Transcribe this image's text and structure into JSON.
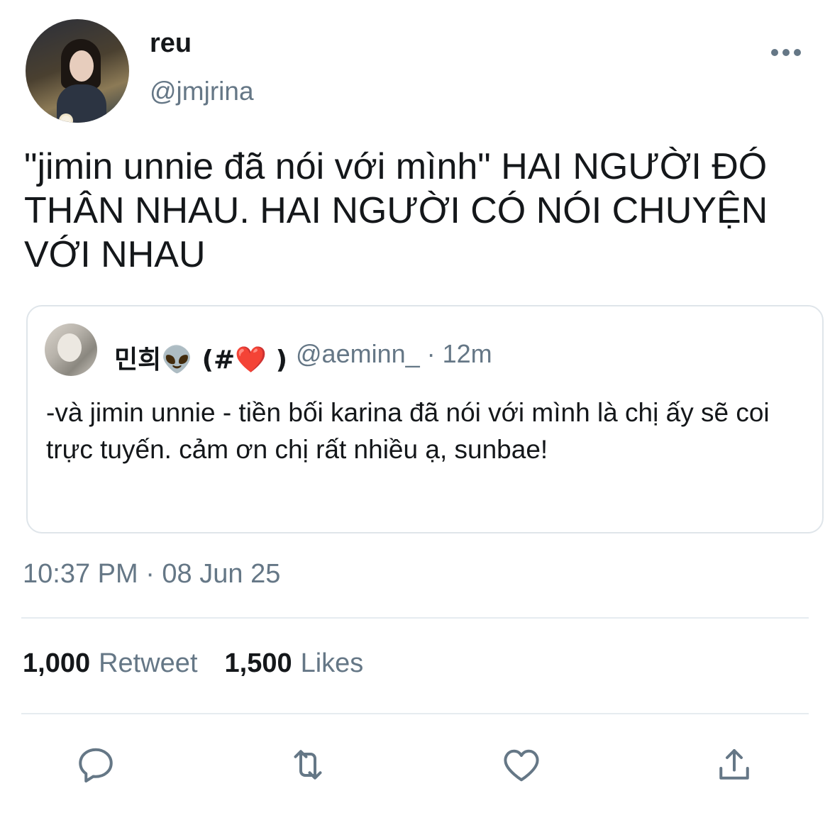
{
  "author": {
    "display_name": "reu",
    "handle": "@jmjrina"
  },
  "more_icon": "more-horizontal-icon",
  "tweet": {
    "text": "\"jimin unnie đã nói với mình\" HAI NGƯỜI ĐÓ THÂN NHAU. HAI NGƯỜI CÓ NÓI CHUYỆN VỚI NHAU",
    "timestamp": "10:37 PM · 08 Jun 25"
  },
  "quoted_tweet": {
    "name": "민희👽 (#❤️ )",
    "meta": "@aeminn_ · 12m",
    "text": "-và jimin unnie - tiền bối karina đã nói với mình là chị ấy sẽ coi trực tuyến. cảm ơn chị rất nhiều ạ, sunbae!"
  },
  "stats": {
    "retweets_count": "1,000",
    "retweets_label": "Retweet",
    "likes_count": "1,500",
    "likes_label": "Likes"
  },
  "actions": {
    "reply_icon": "reply-icon",
    "retweet_icon": "retweet-icon",
    "like_icon": "heart-icon",
    "share_icon": "share-icon"
  },
  "colors": {
    "text": "#14171a",
    "secondary": "#657786",
    "border": "#dfe5ea",
    "divider": "#e6ecf0"
  }
}
